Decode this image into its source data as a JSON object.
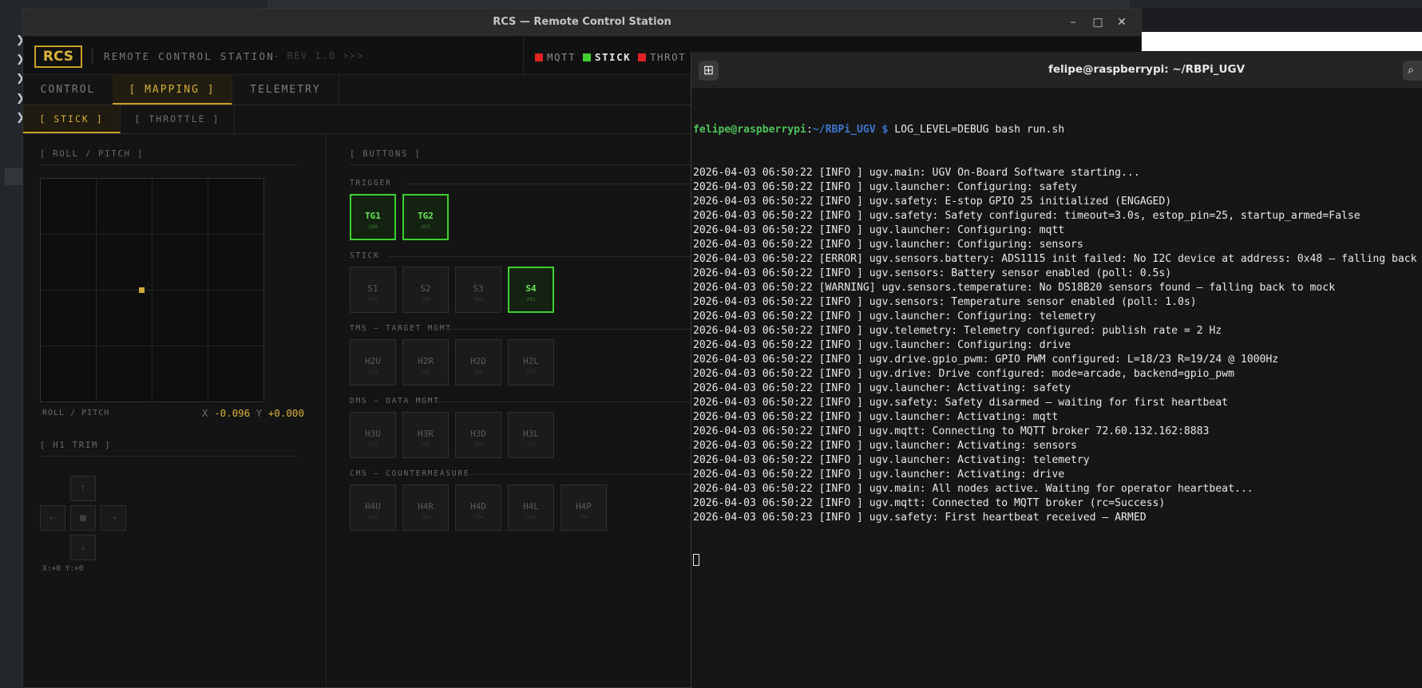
{
  "rcs": {
    "window_title": "RCS — Remote Control Station",
    "logo": "RCS",
    "station_name": "REMOTE CONTROL STATION",
    "revision": "- REV 1.0 >>>",
    "status": [
      {
        "label": "MQTT",
        "color": "#e02424"
      },
      {
        "label": "STICK",
        "color": "#3fcf2e"
      },
      {
        "label": "THROT",
        "color": "#e02424"
      }
    ],
    "tabs": [
      "CONTROL",
      "[ MAPPING ]",
      "TELEMETRY"
    ],
    "subtabs": [
      "[ STICK ]",
      "[ THROTTLE ]"
    ],
    "roll_pitch": {
      "section_title": "[ ROLL / PITCH ]",
      "caption": "ROLL / PITCH",
      "x_label": "X",
      "x_value": "-0.096",
      "y_label": "Y",
      "y_value": "+0.000"
    },
    "h1_trim": {
      "section_title": "[ H1 TRIM ]",
      "up": "↑",
      "left": "←",
      "center": "■",
      "right": "→",
      "down": "↓",
      "readout": "X:+0 Y:+0"
    },
    "buttons_panel": {
      "section_title": "[ BUTTONS ]",
      "groups": [
        {
          "title": "TRIGGER",
          "buttons": [
            {
              "label": "TG1",
              "code": "288",
              "active": true
            },
            {
              "label": "TG2",
              "code": "293",
              "active": true
            }
          ]
        },
        {
          "title": "STICK",
          "buttons": [
            {
              "label": "S1",
              "code": "292",
              "active": false
            },
            {
              "label": "S2",
              "code": "289",
              "active": false
            },
            {
              "label": "S3",
              "code": "290",
              "active": false
            },
            {
              "label": "S4",
              "code": "291",
              "active": true
            }
          ]
        },
        {
          "title": "TMS — TARGET MGMT",
          "buttons": [
            {
              "label": "H2U",
              "code": "294",
              "active": false
            },
            {
              "label": "H2R",
              "code": "295",
              "active": false
            },
            {
              "label": "H2D",
              "code": "296",
              "active": false
            },
            {
              "label": "H2L",
              "code": "297",
              "active": false
            }
          ]
        },
        {
          "title": "DMS — DATA MGMT",
          "buttons": [
            {
              "label": "H3U",
              "code": "298",
              "active": false
            },
            {
              "label": "H3R",
              "code": "299",
              "active": false
            },
            {
              "label": "H3D",
              "code": "300",
              "active": false
            },
            {
              "label": "H3L",
              "code": "301",
              "active": false
            }
          ]
        },
        {
          "title": "CMS — COUNTERMEASURE",
          "buttons": [
            {
              "label": "H4U",
              "code": "302",
              "active": false
            },
            {
              "label": "H4R",
              "code": "303",
              "active": false
            },
            {
              "label": "H4D",
              "code": "704",
              "active": false
            },
            {
              "label": "H4L",
              "code": "705",
              "active": false
            },
            {
              "label": "H4P",
              "code": "706",
              "active": false
            }
          ]
        }
      ]
    }
  },
  "terminal": {
    "title": "felipe@raspberrypi: ~/RBPi_UGV",
    "prompt_user": "felipe@raspberrypi",
    "prompt_sep": ":",
    "prompt_path": "~/RBPi_UGV",
    "prompt_symbol": " $ ",
    "command": "LOG_LEVEL=DEBUG bash run.sh",
    "log_lines": [
      "2026-04-03 06:50:22 [INFO ] ugv.main: UGV On-Board Software starting...",
      "2026-04-03 06:50:22 [INFO ] ugv.launcher: Configuring: safety",
      "2026-04-03 06:50:22 [INFO ] ugv.safety: E-stop GPIO 25 initialized (ENGAGED)",
      "2026-04-03 06:50:22 [INFO ] ugv.safety: Safety configured: timeout=3.0s, estop_pin=25, startup_armed=False",
      "2026-04-03 06:50:22 [INFO ] ugv.launcher: Configuring: mqtt",
      "2026-04-03 06:50:22 [INFO ] ugv.launcher: Configuring: sensors",
      "2026-04-03 06:50:22 [ERROR] ugv.sensors.battery: ADS1115 init failed: No I2C device at address: 0x48 — falling back",
      "2026-04-03 06:50:22 [INFO ] ugv.sensors: Battery sensor enabled (poll: 0.5s)",
      "2026-04-03 06:50:22 [WARNING] ugv.sensors.temperature: No DS18B20 sensors found — falling back to mock",
      "2026-04-03 06:50:22 [INFO ] ugv.sensors: Temperature sensor enabled (poll: 1.0s)",
      "2026-04-03 06:50:22 [INFO ] ugv.launcher: Configuring: telemetry",
      "2026-04-03 06:50:22 [INFO ] ugv.telemetry: Telemetry configured: publish rate = 2 Hz",
      "2026-04-03 06:50:22 [INFO ] ugv.launcher: Configuring: drive",
      "2026-04-03 06:50:22 [INFO ] ugv.drive.gpio_pwm: GPIO PWM configured: L=18/23 R=19/24 @ 1000Hz",
      "2026-04-03 06:50:22 [INFO ] ugv.drive: Drive configured: mode=arcade, backend=gpio_pwm",
      "2026-04-03 06:50:22 [INFO ] ugv.launcher: Activating: safety",
      "2026-04-03 06:50:22 [INFO ] ugv.safety: Safety disarmed — waiting for first heartbeat",
      "2026-04-03 06:50:22 [INFO ] ugv.launcher: Activating: mqtt",
      "2026-04-03 06:50:22 [INFO ] ugv.mqtt: Connecting to MQTT broker 72.60.132.162:8883",
      "2026-04-03 06:50:22 [INFO ] ugv.launcher: Activating: sensors",
      "2026-04-03 06:50:22 [INFO ] ugv.launcher: Activating: telemetry",
      "2026-04-03 06:50:22 [INFO ] ugv.launcher: Activating: drive",
      "2026-04-03 06:50:22 [INFO ] ugv.main: All nodes active. Waiting for operator heartbeat...",
      "2026-04-03 06:50:22 [INFO ] ugv.mqtt: Connected to MQTT broker (rc=Success)",
      "2026-04-03 06:50:23 [INFO ] ugv.safety: First heartbeat received — ARMED"
    ]
  }
}
